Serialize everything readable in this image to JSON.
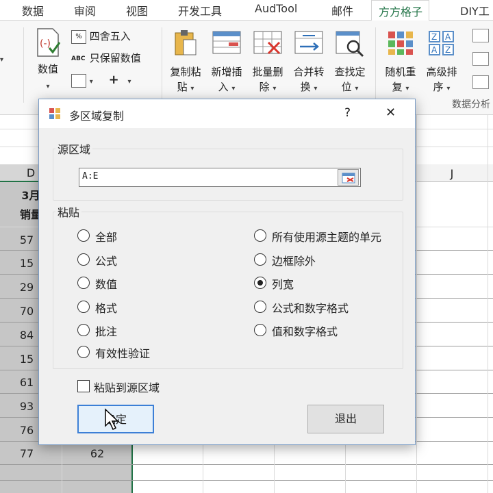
{
  "tabs": [
    "数据",
    "审阅",
    "视图",
    "开发工具",
    "AudTool",
    "邮件",
    "方方格子",
    "DIY工"
  ],
  "active_tab": "方方格子",
  "ribbon": {
    "numvalue": "数值",
    "round": "四舍五入",
    "keep_value": "只保留数值",
    "copy_paste": [
      "复制粘",
      "贴"
    ],
    "add_insert": [
      "新增插",
      "入"
    ],
    "batch_delete": [
      "批量删",
      "除"
    ],
    "merge_convert": [
      "合并转",
      "换"
    ],
    "find_locate": [
      "查找定",
      "位"
    ],
    "random_repeat": [
      "随机重",
      "复"
    ],
    "adv_sort": [
      "高级排",
      "序"
    ],
    "group_label": "数据分析",
    "plus": "+"
  },
  "sheet": {
    "col_d": "D",
    "col_j": "J",
    "header_month": "3月",
    "header_sales": "销量",
    "col_d_values": [
      "57",
      "15",
      "29",
      "70",
      "84",
      "15",
      "61",
      "93",
      "76",
      "77"
    ],
    "col_e_last": "62"
  },
  "dialog": {
    "title": "多区域复制",
    "help": "?",
    "close": "✕",
    "source_group": "源区域",
    "source_value": "A:E",
    "paste_group": "粘贴",
    "options_left": [
      "全部",
      "公式",
      "数值",
      "格式",
      "批注",
      "有效性验证"
    ],
    "options_right": [
      "所有使用源主题的单元",
      "边框除外",
      "列宽",
      "公式和数字格式",
      "值和数字格式"
    ],
    "selected_option": "列宽",
    "paste_to_source": "粘贴到源区域",
    "paste_to_source_checked": false,
    "ok": "确定",
    "exit": "退出"
  },
  "colors": {
    "accent_green": "#217346",
    "dialog_border": "#7a9cc6",
    "selected_col_bg": "#c6c6c6"
  }
}
